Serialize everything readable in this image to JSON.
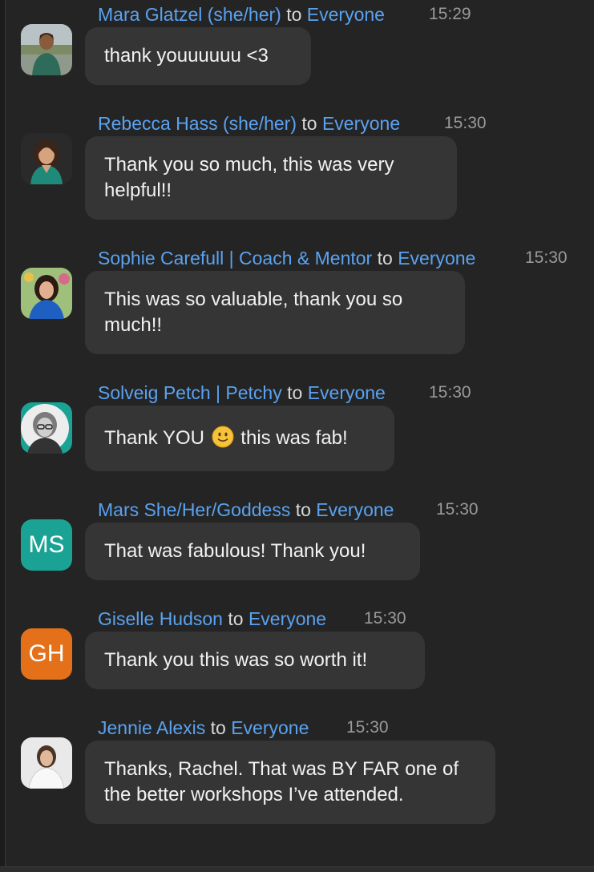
{
  "chat": {
    "to_word": "to",
    "messages": [
      {
        "sender": "Mara Glatzel (she/her)",
        "recipient": "Everyone",
        "time": "15:29",
        "text": "thank youuuuuu <3"
      },
      {
        "sender": "Rebecca Hass (she/her)",
        "recipient": "Everyone",
        "time": "15:30",
        "text": "Thank you so much, this was very helpful!!"
      },
      {
        "sender": "Sophie Carefull | Coach & Mentor",
        "recipient": "Everyone",
        "time": "15:30",
        "text": "This was so valuable, thank you so much!!"
      },
      {
        "sender": "Solveig Petch | Petchy",
        "recipient": "Everyone",
        "time": "15:30",
        "text_before": "Thank YOU",
        "text_after": "this was fab!",
        "emoji": "slightly-smiling-face"
      },
      {
        "sender": "Mars She/Her/Goddess",
        "recipient": "Everyone",
        "time": "15:30",
        "initials": "MS",
        "avatar_color": "#1aa394",
        "text": "That was fabulous! Thank you!"
      },
      {
        "sender": "Giselle Hudson",
        "recipient": "Everyone",
        "time": "15:30",
        "initials": "GH",
        "avatar_color": "#e4701a",
        "text": "Thank you this was so worth it!"
      },
      {
        "sender": "Jennie Alexis",
        "recipient": "Everyone",
        "time": "15:30",
        "text": "Thanks, Rachel. That was BY FAR one of the better workshops I’ve attended."
      }
    ]
  }
}
